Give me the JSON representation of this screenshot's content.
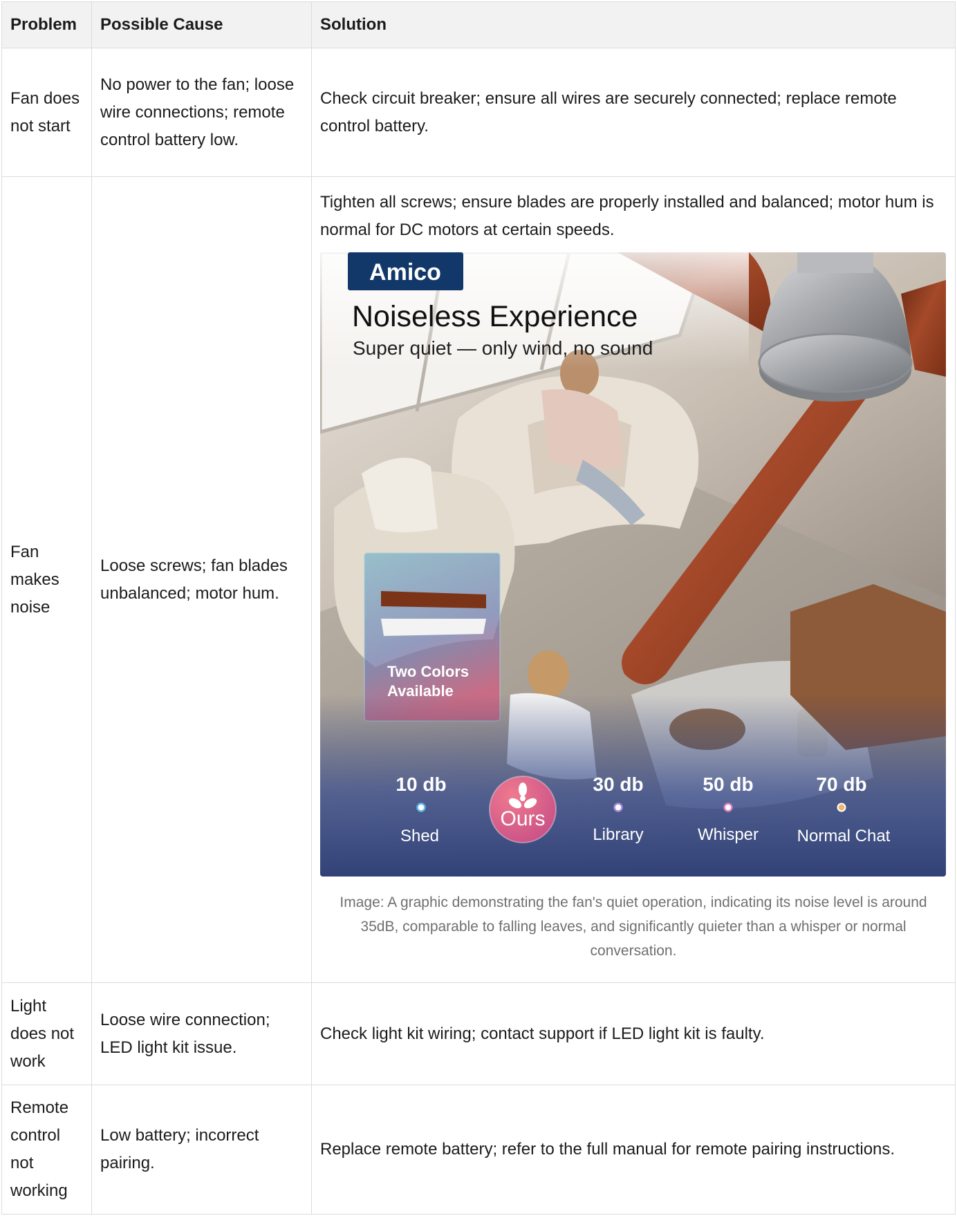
{
  "table": {
    "headers": [
      "Problem",
      "Possible Cause",
      "Solution"
    ],
    "rows": [
      {
        "problem": "Fan does not start",
        "cause": "No power to the fan; loose wire connections; remote control battery low.",
        "solution": "Check circuit breaker; ensure all wires are securely connected; replace remote control battery."
      },
      {
        "problem": "Fan makes noise",
        "cause": "Loose screws; fan blades unbalanced; motor hum.",
        "solution": "Tighten all screws; ensure blades are properly installed and balanced; motor hum is normal for DC motors at certain speeds."
      },
      {
        "problem": "Light does not work",
        "cause": "Loose wire connection; LED light kit issue.",
        "solution": "Check light kit wiring; contact support if LED light kit is faulty."
      },
      {
        "problem": "Remote control not working",
        "cause": "Low battery; incorrect pairing.",
        "solution": "Replace remote battery; refer to the full manual for remote pairing instructions."
      }
    ]
  },
  "promo": {
    "brand": "Amico",
    "title": "Noiseless Experience",
    "subtitle": "Super quiet — only wind, no sound",
    "colors_badge_line1": "Two Colors",
    "colors_badge_line2": "Available",
    "ours_label": "Ours",
    "scale": [
      {
        "db": "10 db",
        "label": "Shed"
      },
      {
        "db": "30 db",
        "label": "Library"
      },
      {
        "db": "50 db",
        "label": "Whisper"
      },
      {
        "db": "70 db",
        "label": "Normal Chat"
      }
    ],
    "colors": {
      "brand_navy": "#12386a",
      "blade_wood": "#8e3a1c",
      "ours_badge": "#d8567d",
      "scale_blue": "#5fb7ea",
      "scale_pink": "#d77bb7",
      "scale_orange": "#f2b56f"
    }
  },
  "caption": "Image: A graphic demonstrating the fan's quiet operation, indicating its noise level is around 35dB, comparable to falling leaves, and significantly quieter than a whisper or normal conversation."
}
